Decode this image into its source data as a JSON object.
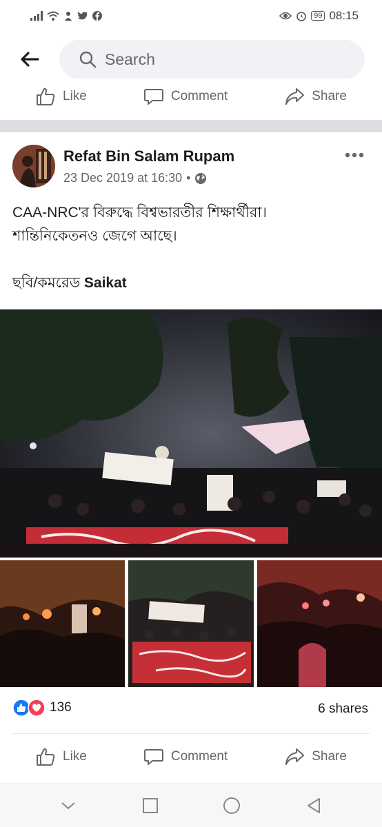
{
  "status_bar": {
    "time": "08:15",
    "battery": "99",
    "icons": [
      "signal-icon",
      "wifi-icon",
      "notification-app-icon",
      "twitter-icon",
      "facebook-icon",
      "eye-comfort-icon",
      "alarm-icon",
      "battery-icon"
    ]
  },
  "search": {
    "placeholder": "Search"
  },
  "actions": {
    "like": "Like",
    "comment": "Comment",
    "share": "Share"
  },
  "post": {
    "author": "Refat Bin Salam Rupam",
    "timestamp": "23 Dec 2019 at 16:30",
    "separator": "•",
    "text_line1": "CAA-NRC'র বিরুদ্ধে বিশ্বভারতীর শিক্ষার্থীরা।",
    "text_line2": "শান্তিনিকেতনও জেগে আছে।",
    "credit_prefix": "ছবি/কমরেড ",
    "credit_name": "Saikat",
    "reaction_count": "136",
    "shares": "6 shares"
  },
  "colors": {
    "accent_blue": "#1877f2",
    "love_red": "#f33e58",
    "muted_text": "#65676b",
    "divider": "#dcdee2"
  }
}
